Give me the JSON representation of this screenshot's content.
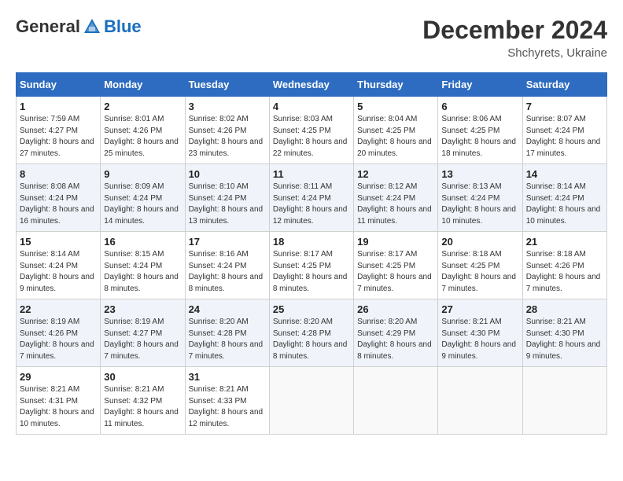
{
  "header": {
    "logo_general": "General",
    "logo_blue": "Blue",
    "month_title": "December 2024",
    "location": "Shchyrets, Ukraine"
  },
  "calendar": {
    "days_of_week": [
      "Sunday",
      "Monday",
      "Tuesday",
      "Wednesday",
      "Thursday",
      "Friday",
      "Saturday"
    ],
    "weeks": [
      [
        {
          "day": "1",
          "sunrise": "7:59 AM",
          "sunset": "4:27 PM",
          "daylight": "8 hours and 27 minutes."
        },
        {
          "day": "2",
          "sunrise": "8:01 AM",
          "sunset": "4:26 PM",
          "daylight": "8 hours and 25 minutes."
        },
        {
          "day": "3",
          "sunrise": "8:02 AM",
          "sunset": "4:26 PM",
          "daylight": "8 hours and 23 minutes."
        },
        {
          "day": "4",
          "sunrise": "8:03 AM",
          "sunset": "4:25 PM",
          "daylight": "8 hours and 22 minutes."
        },
        {
          "day": "5",
          "sunrise": "8:04 AM",
          "sunset": "4:25 PM",
          "daylight": "8 hours and 20 minutes."
        },
        {
          "day": "6",
          "sunrise": "8:06 AM",
          "sunset": "4:25 PM",
          "daylight": "8 hours and 18 minutes."
        },
        {
          "day": "7",
          "sunrise": "8:07 AM",
          "sunset": "4:24 PM",
          "daylight": "8 hours and 17 minutes."
        }
      ],
      [
        {
          "day": "8",
          "sunrise": "8:08 AM",
          "sunset": "4:24 PM",
          "daylight": "8 hours and 16 minutes."
        },
        {
          "day": "9",
          "sunrise": "8:09 AM",
          "sunset": "4:24 PM",
          "daylight": "8 hours and 14 minutes."
        },
        {
          "day": "10",
          "sunrise": "8:10 AM",
          "sunset": "4:24 PM",
          "daylight": "8 hours and 13 minutes."
        },
        {
          "day": "11",
          "sunrise": "8:11 AM",
          "sunset": "4:24 PM",
          "daylight": "8 hours and 12 minutes."
        },
        {
          "day": "12",
          "sunrise": "8:12 AM",
          "sunset": "4:24 PM",
          "daylight": "8 hours and 11 minutes."
        },
        {
          "day": "13",
          "sunrise": "8:13 AM",
          "sunset": "4:24 PM",
          "daylight": "8 hours and 10 minutes."
        },
        {
          "day": "14",
          "sunrise": "8:14 AM",
          "sunset": "4:24 PM",
          "daylight": "8 hours and 10 minutes."
        }
      ],
      [
        {
          "day": "15",
          "sunrise": "8:14 AM",
          "sunset": "4:24 PM",
          "daylight": "8 hours and 9 minutes."
        },
        {
          "day": "16",
          "sunrise": "8:15 AM",
          "sunset": "4:24 PM",
          "daylight": "8 hours and 8 minutes."
        },
        {
          "day": "17",
          "sunrise": "8:16 AM",
          "sunset": "4:24 PM",
          "daylight": "8 hours and 8 minutes."
        },
        {
          "day": "18",
          "sunrise": "8:17 AM",
          "sunset": "4:25 PM",
          "daylight": "8 hours and 8 minutes."
        },
        {
          "day": "19",
          "sunrise": "8:17 AM",
          "sunset": "4:25 PM",
          "daylight": "8 hours and 7 minutes."
        },
        {
          "day": "20",
          "sunrise": "8:18 AM",
          "sunset": "4:25 PM",
          "daylight": "8 hours and 7 minutes."
        },
        {
          "day": "21",
          "sunrise": "8:18 AM",
          "sunset": "4:26 PM",
          "daylight": "8 hours and 7 minutes."
        }
      ],
      [
        {
          "day": "22",
          "sunrise": "8:19 AM",
          "sunset": "4:26 PM",
          "daylight": "8 hours and 7 minutes."
        },
        {
          "day": "23",
          "sunrise": "8:19 AM",
          "sunset": "4:27 PM",
          "daylight": "8 hours and 7 minutes."
        },
        {
          "day": "24",
          "sunrise": "8:20 AM",
          "sunset": "4:28 PM",
          "daylight": "8 hours and 7 minutes."
        },
        {
          "day": "25",
          "sunrise": "8:20 AM",
          "sunset": "4:28 PM",
          "daylight": "8 hours and 8 minutes."
        },
        {
          "day": "26",
          "sunrise": "8:20 AM",
          "sunset": "4:29 PM",
          "daylight": "8 hours and 8 minutes."
        },
        {
          "day": "27",
          "sunrise": "8:21 AM",
          "sunset": "4:30 PM",
          "daylight": "8 hours and 9 minutes."
        },
        {
          "day": "28",
          "sunrise": "8:21 AM",
          "sunset": "4:30 PM",
          "daylight": "8 hours and 9 minutes."
        }
      ],
      [
        {
          "day": "29",
          "sunrise": "8:21 AM",
          "sunset": "4:31 PM",
          "daylight": "8 hours and 10 minutes."
        },
        {
          "day": "30",
          "sunrise": "8:21 AM",
          "sunset": "4:32 PM",
          "daylight": "8 hours and 11 minutes."
        },
        {
          "day": "31",
          "sunrise": "8:21 AM",
          "sunset": "4:33 PM",
          "daylight": "8 hours and 12 minutes."
        },
        null,
        null,
        null,
        null
      ]
    ],
    "labels": {
      "sunrise": "Sunrise:",
      "sunset": "Sunset:",
      "daylight": "Daylight:"
    }
  }
}
